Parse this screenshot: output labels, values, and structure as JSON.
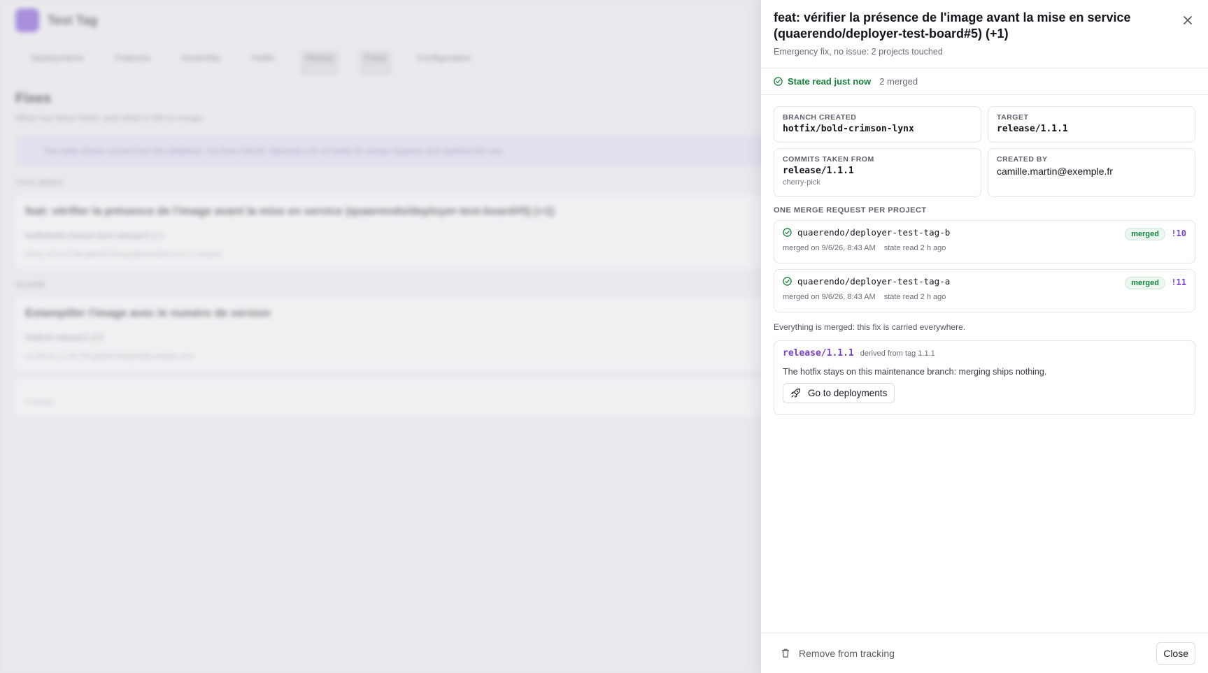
{
  "background": {
    "app_name": "Test Tag",
    "nav": [
      "Deployments",
      "Features",
      "Assembly",
      "Hotfix",
      "History",
      "Fixes",
      "Configuration"
    ],
    "page_title": "Fixes",
    "page_subtitle": "What has been fixed, and what is left to merge",
    "banner": "The state shown comes from the database, not from GitLab. Opening a fix re-reads its merge requests and updates the row.",
    "section_1": "THIS WEEK",
    "card_1_title": "feat: vérifier la présence de l'image avant la mise en service (quaerendo/deployer-test-board#5) (+1)",
    "card_1_row": "hotfix/bold-crimson-lynx     release/1.1.1",
    "card_1_meta": "today at 8:43 AM     gabriel.berger@example.com     2 merged",
    "section_2": "OLDER",
    "card_2_title": "Estampiller l'image avec le numéro de version",
    "card_2_row": "hotfix/tt     release/1.0.0",
    "card_2_meta": "on 8/9 at 12:09 PM     gabriel.berger@example.com",
    "card_3": "2 shown"
  },
  "drawer": {
    "title": "feat: vérifier la présence de l'image avant la mise en service (quaerendo/deployer-test-board#5) (+1)",
    "subtitle": "Emergency fix, no issue: 2 projects touched",
    "status": {
      "label": "State read just now",
      "count": "2 merged",
      "color": "#17803d"
    },
    "info": {
      "branch_created_label": "BRANCH CREATED",
      "branch_created_value": "hotfix/bold-crimson-lynx",
      "target_label": "TARGET",
      "target_value": "release/1.1.1",
      "commits_from_label": "COMMITS TAKEN FROM",
      "commits_from_value": "release/1.1.1",
      "commits_from_note": "cherry-pick",
      "created_by_label": "CREATED BY",
      "created_by_value": "camille.martin@exemple.fr"
    },
    "merge_requests_title": "ONE MERGE REQUEST PER PROJECT",
    "merge_requests": [
      {
        "project": "quaerendo/deployer-test-tag-b",
        "merged_on": "merged on 9/6/26, 8:43 AM",
        "state_read": "state read 2 h ago",
        "badge": "merged",
        "mr_id": "!10"
      },
      {
        "project": "quaerendo/deployer-test-tag-a",
        "merged_on": "merged on 9/6/26, 8:43 AM",
        "state_read": "state read 2 h ago",
        "badge": "merged",
        "mr_id": "!11"
      }
    ],
    "merged_note": "Everything is merged: this fix is carried everywhere.",
    "release": {
      "branch": "release/1.1.1",
      "derived": "derived from tag 1.1.1",
      "description": "The hotfix stays on this maintenance branch: merging ships nothing.",
      "button_label": "Go to deployments"
    },
    "footer": {
      "remove_label": "Remove from tracking",
      "close_label": "Close"
    },
    "accent_color": "#7a3fd1"
  }
}
